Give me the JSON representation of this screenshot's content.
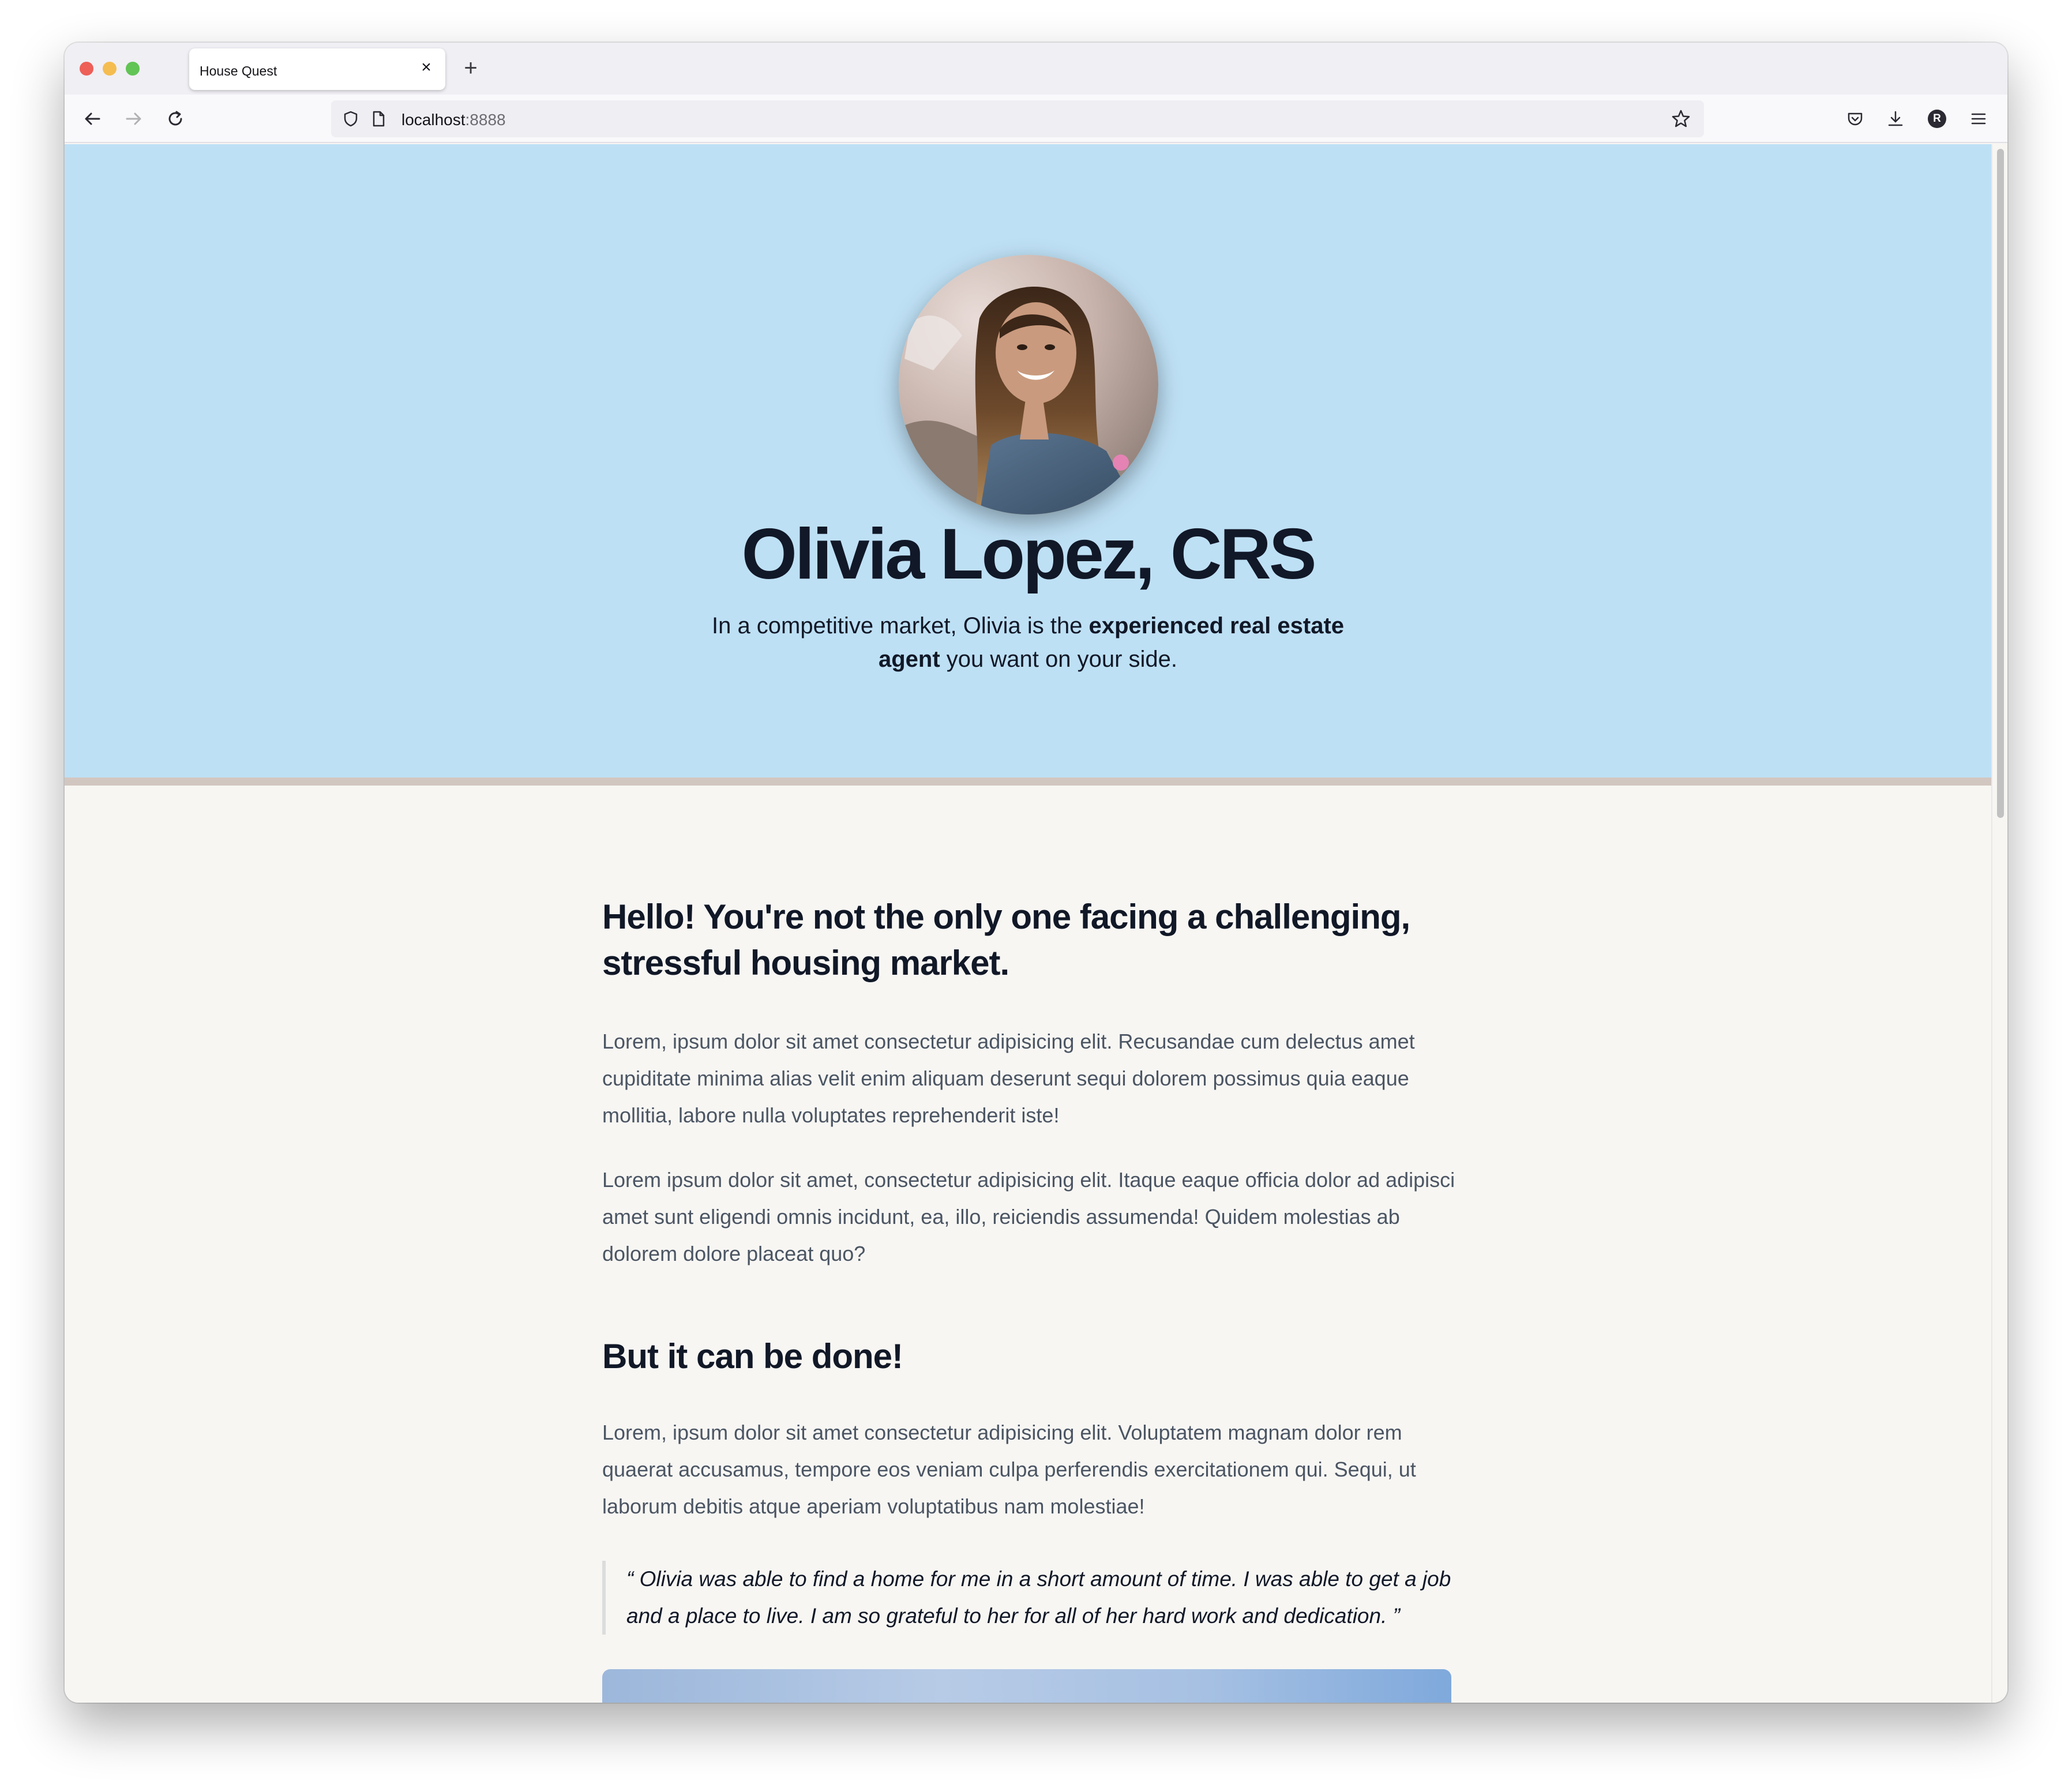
{
  "browser": {
    "tab_title": "House Quest",
    "tab_close": "×",
    "new_tab": "+",
    "url_host": "localhost",
    "url_port": ":8888",
    "account_initial": "R"
  },
  "hero": {
    "name": "Olivia Lopez, CRS",
    "tagline_pre": "In a competitive market, Olivia is the ",
    "tagline_bold": "experienced real estate agent",
    "tagline_post": " you want on your side."
  },
  "content": {
    "heading1": "Hello! You're not the only one facing a challenging, stressful housing market.",
    "paragraph1": "Lorem, ipsum dolor sit amet consectetur adipisicing elit. Recusandae cum delectus amet cupiditate minima alias velit enim aliquam deserunt sequi dolorem possimus quia eaque mollitia, labore nulla voluptates reprehenderit iste!",
    "paragraph2": "Lorem ipsum dolor sit amet, consectetur adipisicing elit. Itaque eaque officia dolor ad adipisci amet sunt eligendi omnis incidunt, ea, illo, reiciendis assumenda! Quidem molestias ab dolorem dolore placeat quo?",
    "heading2": "But it can be done!",
    "paragraph3": "Lorem, ipsum dolor sit amet consectetur adipisicing elit. Voluptatem magnam dolor rem quaerat accusamus, tempore eos veniam culpa perferendis exercitationem qui. Sequi, ut laborum debitis atque aperiam voluptatibus nam molestiae!",
    "quote": "“ Olivia was able to find a home for me in a short amount of time. I was able to get a job and a place to live. I am so grateful to her for all of her hard work and dedication. ”"
  },
  "icons": [
    "back-arrow-icon",
    "forward-arrow-icon",
    "reload-icon",
    "shield-icon",
    "page-icon",
    "star-icon",
    "pocket-icon",
    "download-icon",
    "account-icon",
    "menu-icon"
  ]
}
